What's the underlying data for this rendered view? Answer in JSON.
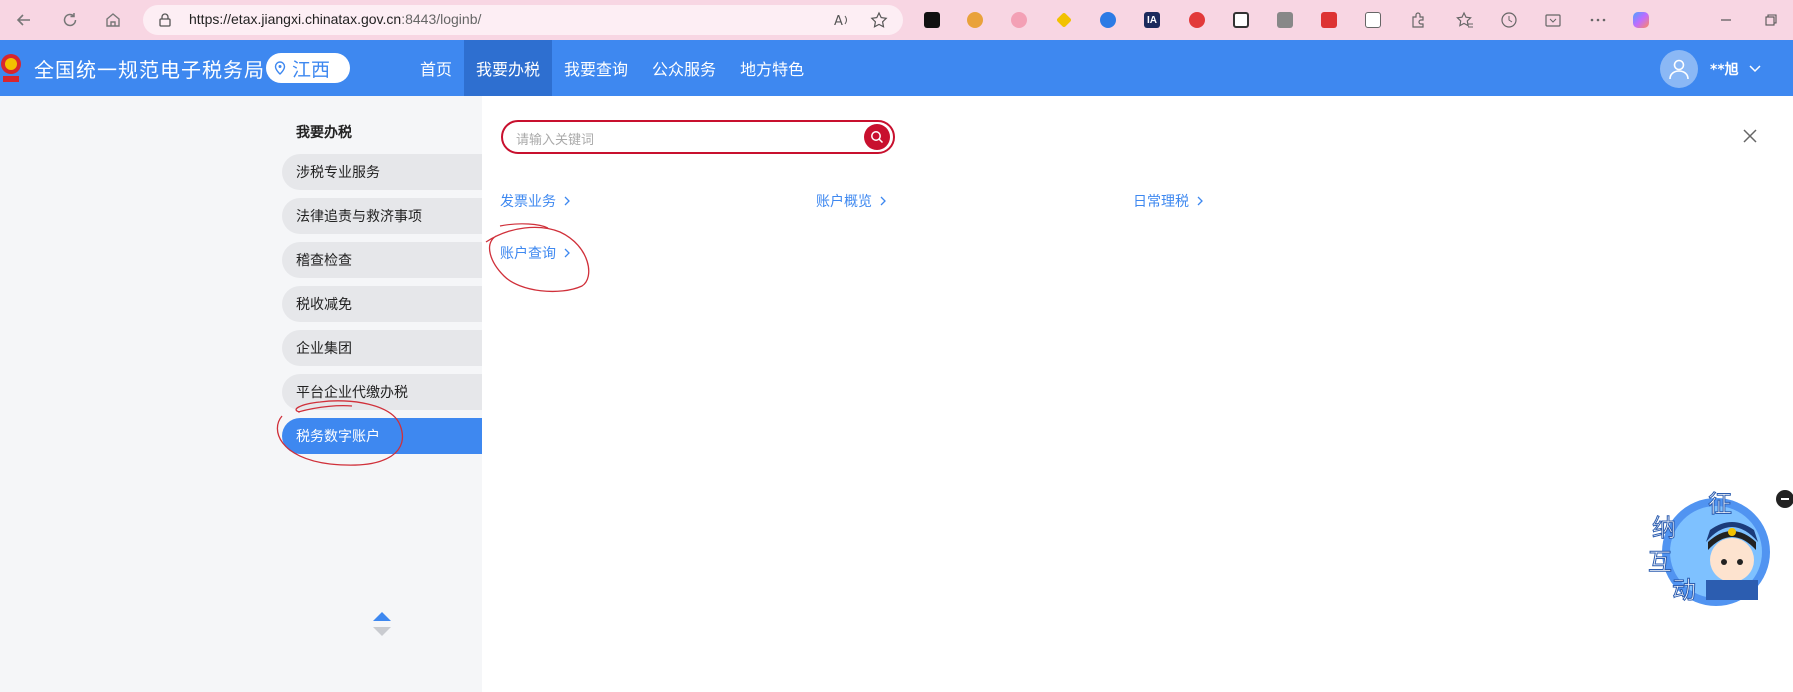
{
  "browser": {
    "url_host": "https://etax.jiangxi.chinatax.gov.cn",
    "url_rest": ":8443/loginb/",
    "extensions": [
      "ext-icon-1",
      "ext-icon-2",
      "ext-icon-3",
      "ext-icon-4",
      "ext-icon-5",
      "ext-icon-6",
      "ext-icon-7",
      "ext-icon-8",
      "ext-icon-9",
      "ext-icon-10",
      "ext-icon-11"
    ],
    "ia_label": "IA"
  },
  "header": {
    "site_title": "全国统一规范电子税务局",
    "region": "江西",
    "nav": [
      {
        "label": "首页"
      },
      {
        "label": "我要办税"
      },
      {
        "label": "我要查询"
      },
      {
        "label": "公众服务"
      },
      {
        "label": "地方特色"
      }
    ],
    "user_name": "**旭",
    "accent": "#3e88f0"
  },
  "sidebar": {
    "heading": "我要办税",
    "items": [
      {
        "label": "涉税专业服务"
      },
      {
        "label": "法律追责与救济事项"
      },
      {
        "label": "稽查检查"
      },
      {
        "label": "税收减免"
      },
      {
        "label": "企业集团"
      },
      {
        "label": "平台企业代缴办税"
      },
      {
        "label": "税务数字账户"
      }
    ],
    "active_index": 6
  },
  "main": {
    "search_placeholder": "请输入关键词",
    "categories": [
      {
        "label": "发票业务"
      },
      {
        "label": "账户概览"
      },
      {
        "label": "日常理税"
      },
      {
        "label": "账户查询"
      }
    ]
  },
  "mascot": {
    "chars": [
      "征",
      "纳",
      "互",
      "动"
    ]
  }
}
